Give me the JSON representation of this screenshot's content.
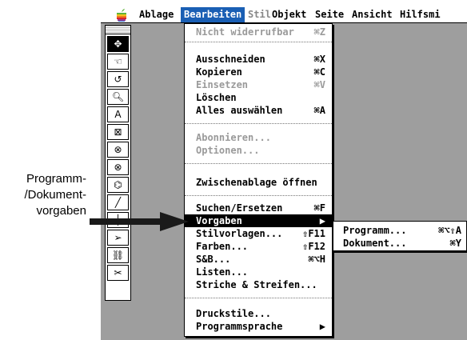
{
  "menubar": {
    "items": [
      {
        "label": "Ablage",
        "state": "normal"
      },
      {
        "label": "Bearbeiten",
        "state": "active"
      },
      {
        "label": "Stil",
        "state": "dim"
      },
      {
        "label": "Objekt",
        "state": "normal"
      },
      {
        "label": "Seite",
        "state": "normal"
      },
      {
        "label": "Ansicht",
        "state": "normal"
      },
      {
        "label": "Hilfsmi",
        "state": "normal"
      }
    ]
  },
  "menu": {
    "items": [
      {
        "label": "Nicht widerrufbar",
        "shortcut": "⌘Z",
        "disabled": true
      },
      {
        "label": "Ausschneiden",
        "shortcut": "⌘X"
      },
      {
        "label": "Kopieren",
        "shortcut": "⌘C"
      },
      {
        "label": "Einsetzen",
        "shortcut": "⌘V",
        "disabled": true
      },
      {
        "label": "Löschen",
        "shortcut": ""
      },
      {
        "label": "Alles auswählen",
        "shortcut": "⌘A"
      },
      {
        "label": "Abonnieren...",
        "shortcut": "",
        "disabled": true
      },
      {
        "label": "Optionen...",
        "shortcut": "",
        "disabled": true
      },
      {
        "label": "Zwischenablage öffnen",
        "shortcut": ""
      },
      {
        "label": "Suchen/Ersetzen",
        "shortcut": "⌘F"
      },
      {
        "label": "Vorgaben",
        "shortcut": "▶",
        "highlighted": true
      },
      {
        "label": "Stilvorlagen...",
        "shortcut": "⇧F11"
      },
      {
        "label": "Farben...",
        "shortcut": "⇧F12"
      },
      {
        "label": "S&B...",
        "shortcut": "⌘⌥H"
      },
      {
        "label": "Listen...",
        "shortcut": ""
      },
      {
        "label": "Striche & Streifen...",
        "shortcut": ""
      },
      {
        "label": "Druckstile...",
        "shortcut": ""
      },
      {
        "label": "Programmsprache",
        "shortcut": "▶"
      }
    ]
  },
  "submenu": {
    "items": [
      {
        "label": "Programm...",
        "shortcut": "⌘⌥⇧A"
      },
      {
        "label": "Dokument...",
        "shortcut": "⌘Y"
      }
    ]
  },
  "callout": {
    "lines": [
      "Programm-",
      "/Dokument-",
      "vorgaben"
    ]
  },
  "toolbox": {
    "tools": [
      "pointer-tool",
      "content-tool",
      "rotate-tool",
      "zoom-tool",
      "text-box-tool",
      "rect-picture-tool",
      "oval-picture-tool",
      "freeform-picture-tool",
      "polygon-tool",
      "line-tool",
      "orthogonal-line-tool",
      "bezier-tool",
      "link-tool",
      "unlink-tool"
    ]
  }
}
